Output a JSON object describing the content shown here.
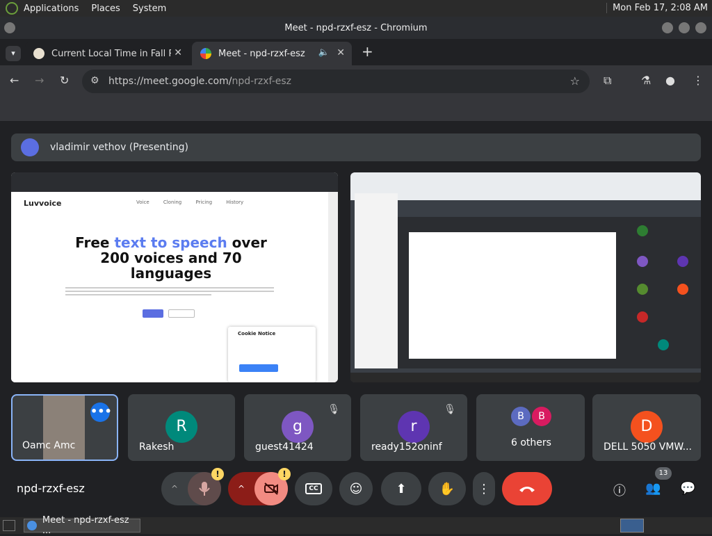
{
  "top_panel": {
    "menus": [
      "Applications",
      "Places",
      "System"
    ],
    "clock": "Mon Feb 17,  2:08 AM"
  },
  "window": {
    "title": "Meet - npd-rzxf-esz - Chromium"
  },
  "tabs": [
    {
      "label": "Current Local Time in Fall Riv"
    },
    {
      "label": "Meet - npd-rzxf-esz"
    }
  ],
  "address": {
    "host": "https://meet.google.com/",
    "path": "npd-rzxf-esz"
  },
  "presenter": {
    "label": "vladimir vethov (Presenting)"
  },
  "shared_screen_left": {
    "logo": "Luvvoice",
    "nav": "Voice Cloning Pricing History",
    "headline_pre": "Free ",
    "headline_highlight": "text to speech",
    "headline_post": " over 200 voices and 70 languages",
    "cookie_title": "Cookie Notice"
  },
  "participants": [
    {
      "name": "Oamc Amc",
      "initial": "",
      "color": ""
    },
    {
      "name": "Rakesh",
      "initial": "R",
      "color": "#00897b"
    },
    {
      "name": "guest41424",
      "initial": "g",
      "color": "#7e57c2"
    },
    {
      "name": "ready152oninf",
      "initial": "r",
      "color": "#5e35b1"
    },
    {
      "name": "6 others",
      "initials": [
        "B",
        "B"
      ],
      "colors": [
        "#5c6bc0",
        "#d81b60"
      ]
    },
    {
      "name": "DELL 5050 VMW...",
      "initial": "D",
      "color": "#f4511e"
    }
  ],
  "meeting_code": "npd-rzxf-esz",
  "people_count": "13",
  "taskbar": {
    "task_label": "Meet - npd-rzxf-esz ..."
  },
  "colors": {
    "accent": "#8ab4f8",
    "leave": "#ea4335",
    "present_more": "#1a73e8"
  }
}
